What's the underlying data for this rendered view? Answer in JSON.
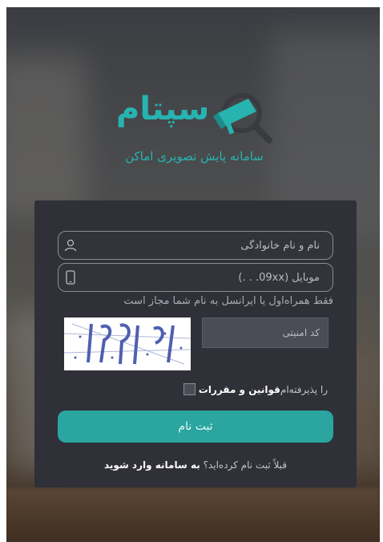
{
  "brand": {
    "title": "سپتام",
    "subtitle": "سامانه پایش تصویری اماکن",
    "icon": "cctv-camera-magnifier-icon",
    "color": "#27b3b0"
  },
  "form": {
    "name_placeholder": "نام و نام خانوادگی",
    "mobile_placeholder": "موبایل (09xx. . .)",
    "mobile_hint": "فقط همراه‌اول یا ایرانسل به نام شما مجاز است",
    "captcha_placeholder": "کد امنیتی",
    "terms_label_bold": "قوانین و مقررات",
    "terms_label_rest": "را پذیرفته‌ام",
    "terms_checked": false,
    "submit_label": "ثبت نام",
    "login_question": "قبلاً ثبت نام کرده‌اید؟",
    "login_link": "به سامانه وارد شوید",
    "accent": "#2aa5a0"
  }
}
